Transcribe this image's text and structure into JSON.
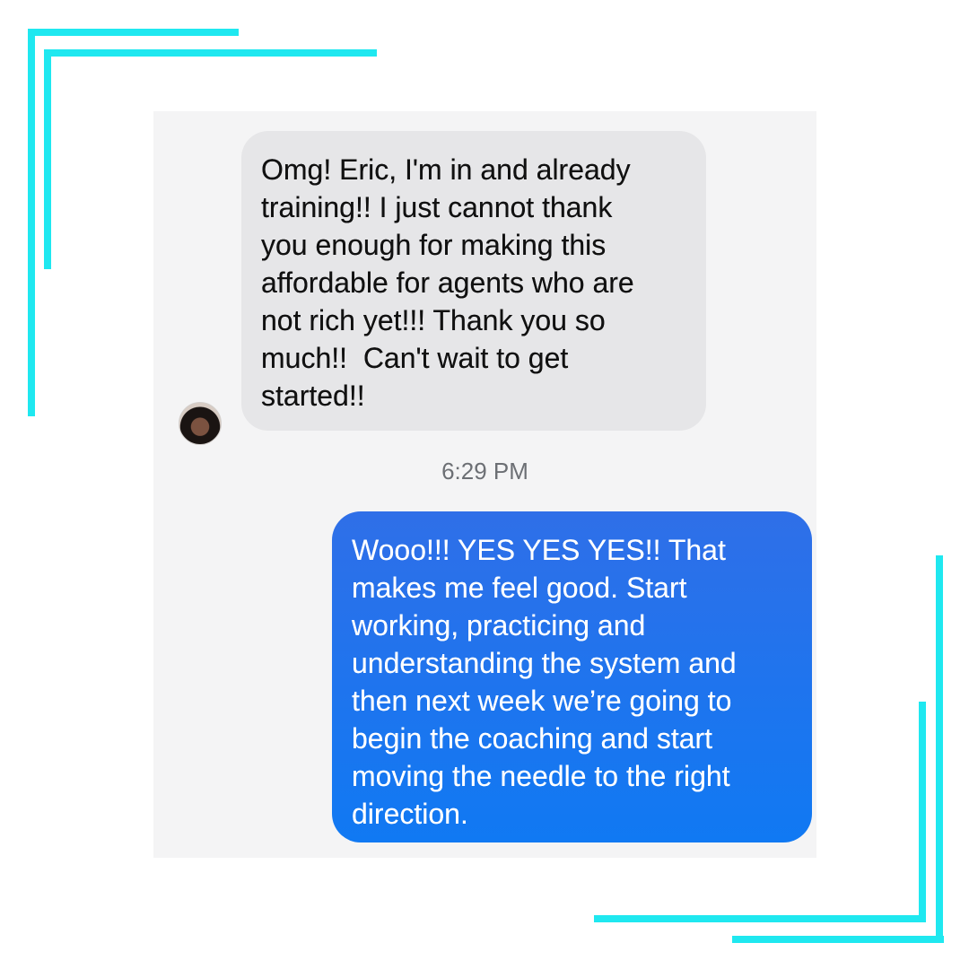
{
  "conversation": {
    "incoming_message": "Omg! Eric, I'm in and already\ntraining!! I just cannot thank\nyou enough for making this\naffordable for agents who are\nnot rich yet!!! Thank you so\nmuch!!  Can't wait to get\nstarted!!",
    "timestamp": "6:29 PM",
    "outgoing_message": "Wooo!!! YES YES YES!! That\nmakes me feel good. Start\nworking, practicing and\nunderstanding the system and\nthen next week we’re going to\nbegin the coaching and start\nmoving the needle to the right\ndirection."
  },
  "colors": {
    "accent": "#1fe8f0",
    "incoming_bubble": "#e6e6e8",
    "outgoing_bubble": "#1079f3",
    "background": "#f4f4f5"
  },
  "icons": {
    "avatar": "avatar"
  }
}
